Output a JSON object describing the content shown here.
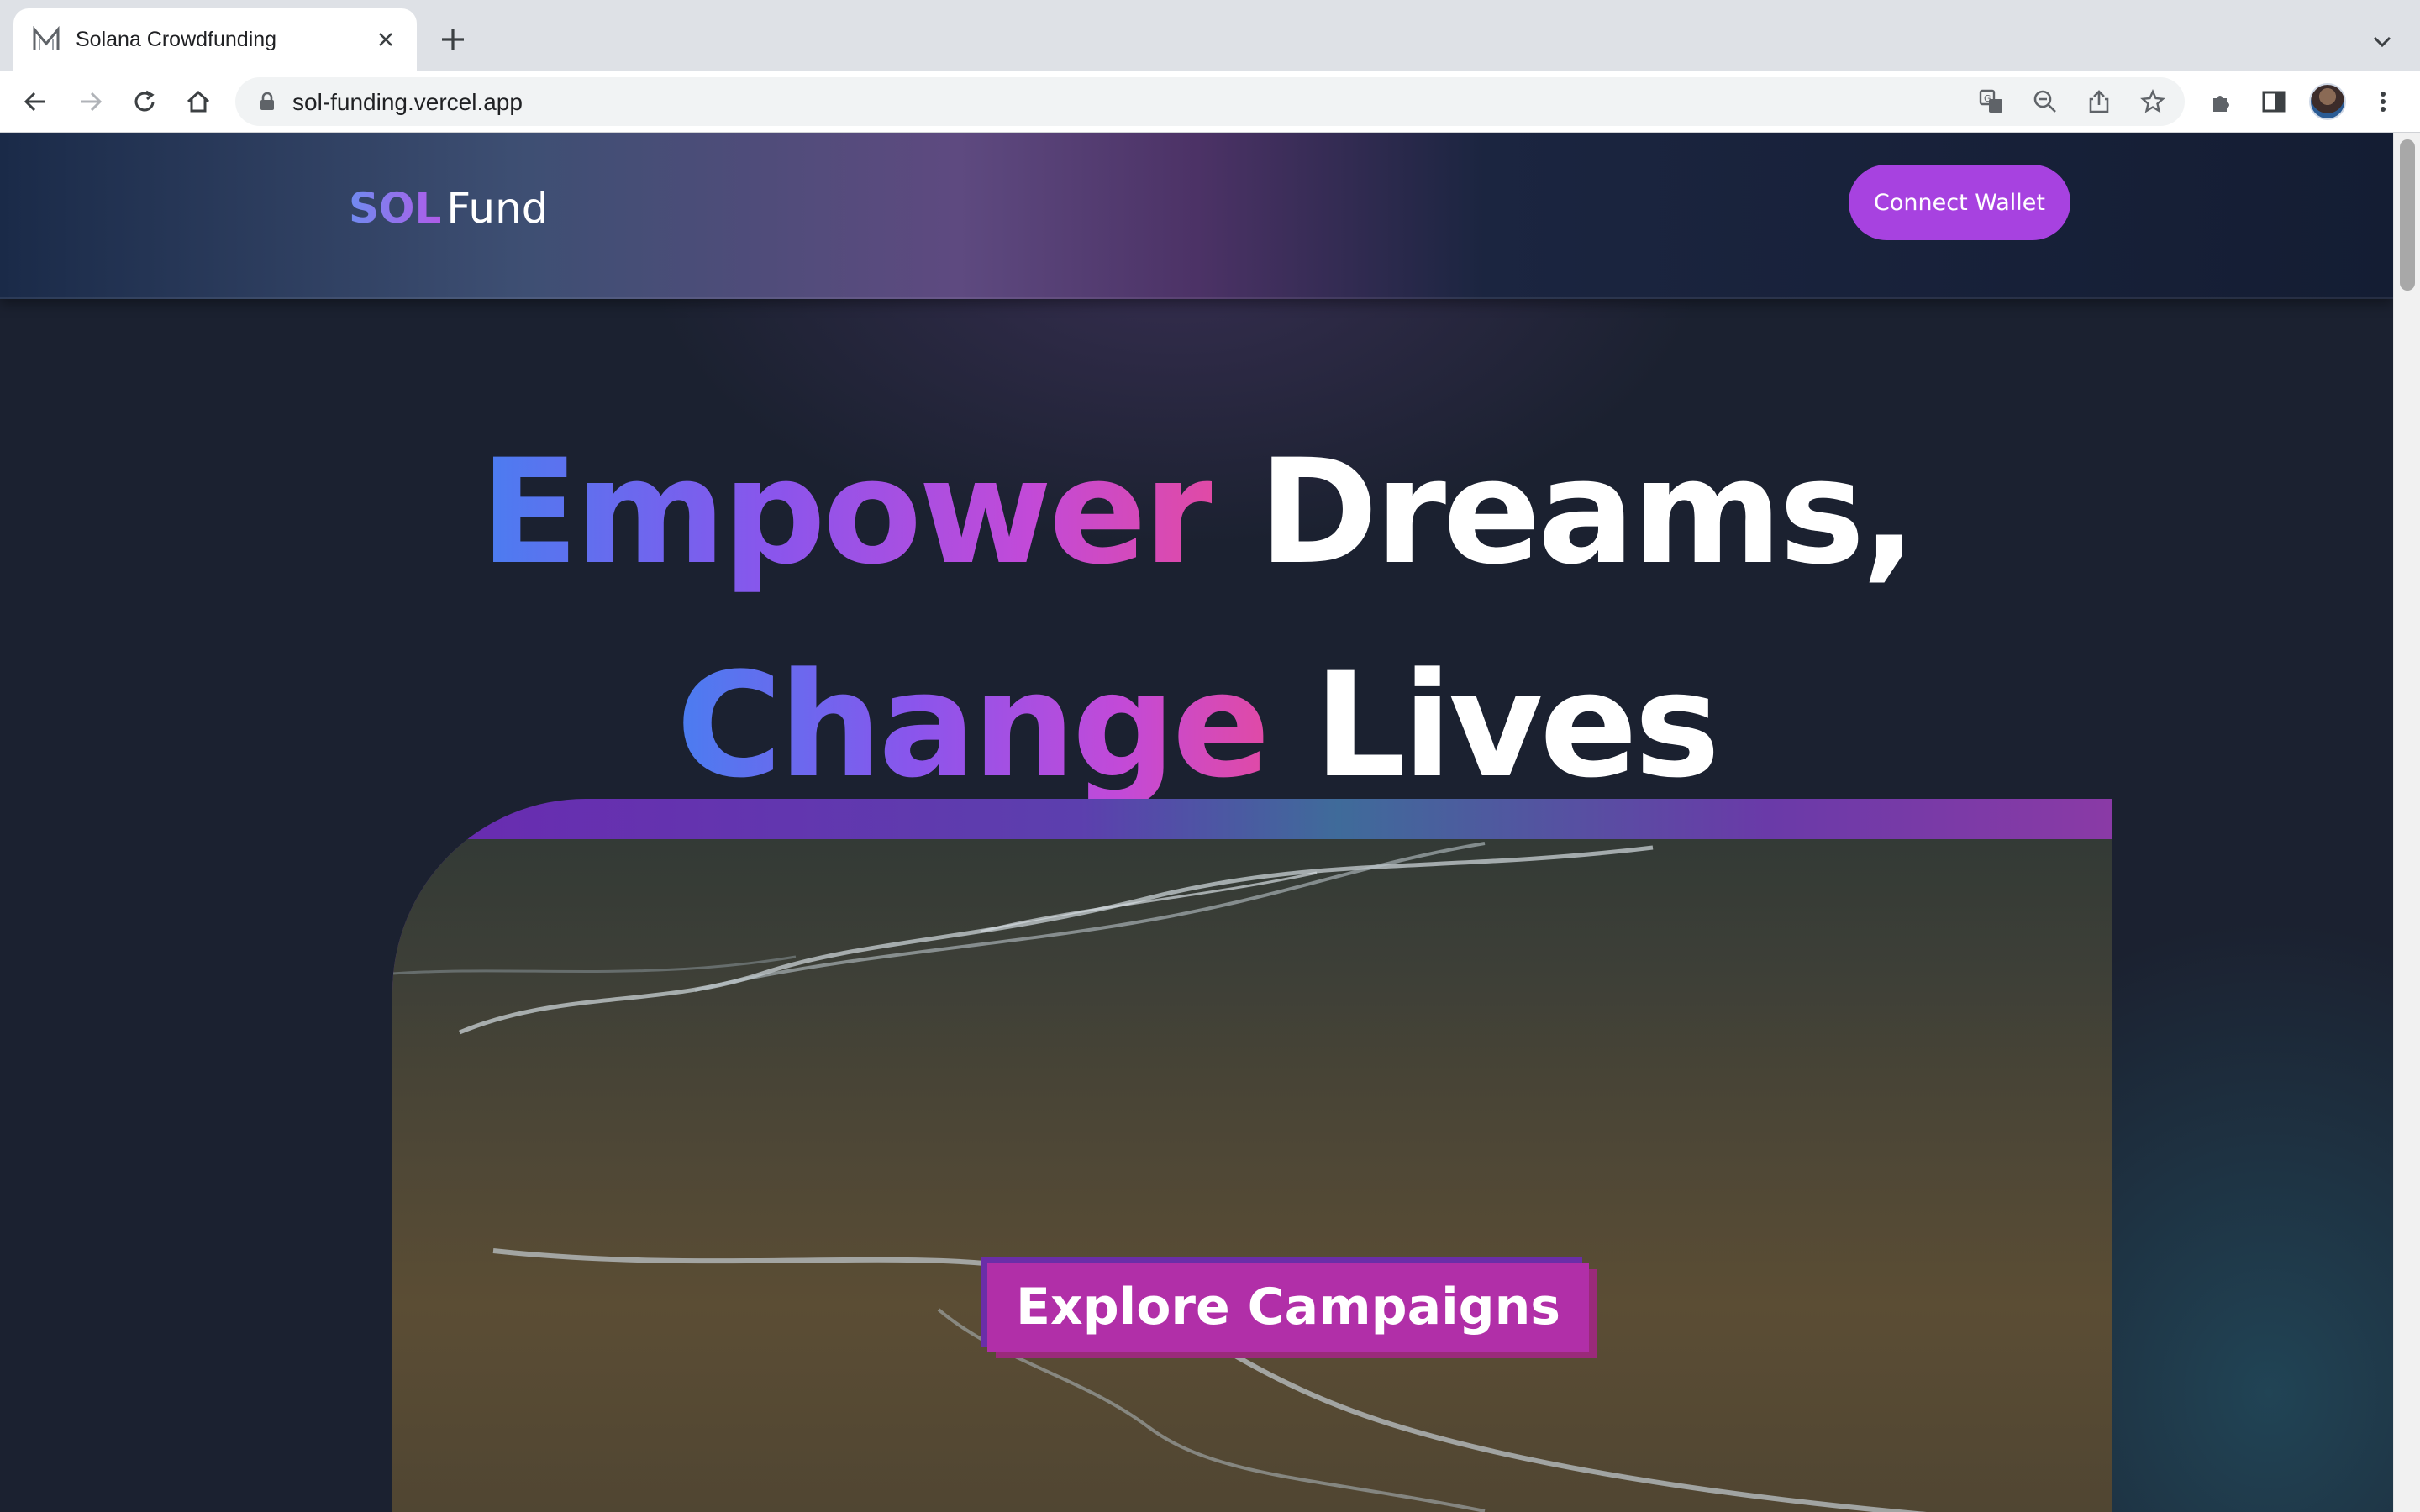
{
  "browser": {
    "tab": {
      "title": "Solana Crowdfunding",
      "favicon": "m-logo-icon"
    },
    "url": "sol-funding.vercel.app",
    "toolbar_icons": [
      "back-icon",
      "forward-icon",
      "reload-icon",
      "home-icon",
      "lock-icon",
      "translate-icon",
      "zoom-out-icon",
      "share-icon",
      "star-icon",
      "extensions-icon",
      "side-panel-icon",
      "avatar",
      "more-icon"
    ]
  },
  "navbar": {
    "logo_sol": "SOL",
    "logo_fund": "Fund",
    "connect_label": "Connect Wallet"
  },
  "hero": {
    "line1_grad": "Empower",
    "line1_white": "Dreams,",
    "line2_grad": "Change",
    "line2_white": "Lives",
    "cta_label": "Explore Campaigns"
  },
  "colors": {
    "accent": "#a742e0",
    "cta": "#b12fa8",
    "background": "#1b2130"
  }
}
